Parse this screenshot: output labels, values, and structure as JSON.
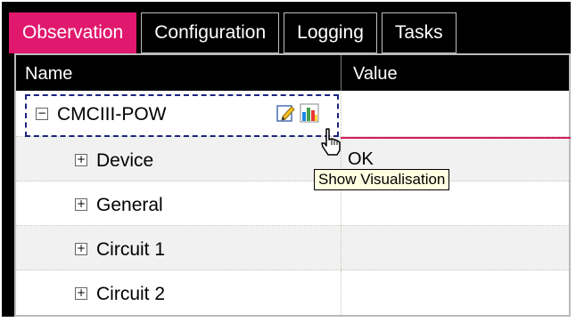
{
  "tabs": [
    {
      "label": "Observation",
      "active": true
    },
    {
      "label": "Configuration",
      "active": false
    },
    {
      "label": "Logging",
      "active": false
    },
    {
      "label": "Tasks",
      "active": false
    }
  ],
  "table": {
    "headers": {
      "name": "Name",
      "value": "Value"
    },
    "rows": [
      {
        "label": "CMCIII-POW",
        "toggle": "−",
        "value": ""
      },
      {
        "label": "Device",
        "toggle": "+",
        "value": "OK"
      },
      {
        "label": "General",
        "toggle": "+",
        "value": ""
      },
      {
        "label": "Circuit 1",
        "toggle": "+",
        "value": ""
      },
      {
        "label": "Circuit 2",
        "toggle": "+",
        "value": ""
      }
    ]
  },
  "tooltip": {
    "text": "Show Visualisation"
  },
  "icons": {
    "edit": "edit-pencil-icon",
    "visualise": "bar-chart-icon",
    "cursor": "hand-pointer-cursor"
  },
  "colors": {
    "accent": "#e0186e",
    "selection": "#1a237e"
  }
}
